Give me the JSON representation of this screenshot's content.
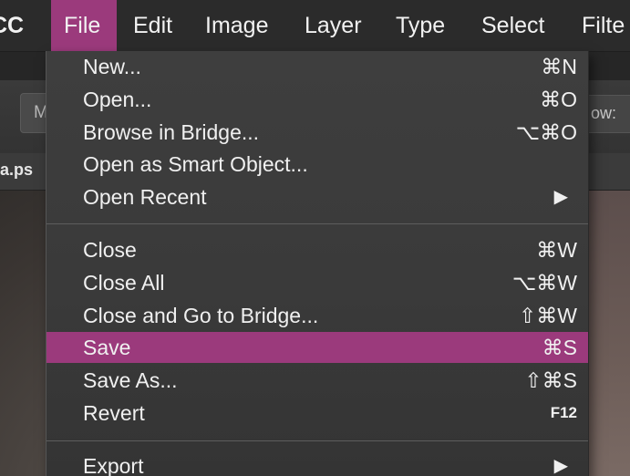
{
  "menubar": {
    "app_fragment": "CC",
    "items": [
      "File",
      "Edit",
      "Image",
      "Layer",
      "Type",
      "Select",
      "Filte"
    ]
  },
  "background": {
    "tool_button_label": "M",
    "options_label": "ow:",
    "doc_tab_label": "a.ps"
  },
  "file_menu": {
    "new": {
      "label": "New...",
      "shortcut": "⌘N"
    },
    "open": {
      "label": "Open...",
      "shortcut": "⌘O"
    },
    "browse_bridge": {
      "label": "Browse in Bridge...",
      "shortcut": "⌥⌘O"
    },
    "open_smart_object": {
      "label": "Open as Smart Object..."
    },
    "open_recent": {
      "label": "Open Recent",
      "arrow": "▶"
    },
    "close": {
      "label": "Close",
      "shortcut": "⌘W"
    },
    "close_all": {
      "label": "Close All",
      "shortcut": "⌥⌘W"
    },
    "close_go_bridge": {
      "label": "Close and Go to Bridge...",
      "shortcut": "⇧⌘W"
    },
    "save": {
      "label": "Save",
      "shortcut": "⌘S"
    },
    "save_as": {
      "label": "Save As...",
      "shortcut": "⇧⌘S"
    },
    "revert": {
      "label": "Revert",
      "shortcut": "F12"
    },
    "export": {
      "label": "Export",
      "arrow": "▶"
    }
  },
  "colors": {
    "highlight": "#9b3a7c",
    "menu_bg": "#3c3c3c",
    "menubar_bg": "#2b2b2b"
  }
}
